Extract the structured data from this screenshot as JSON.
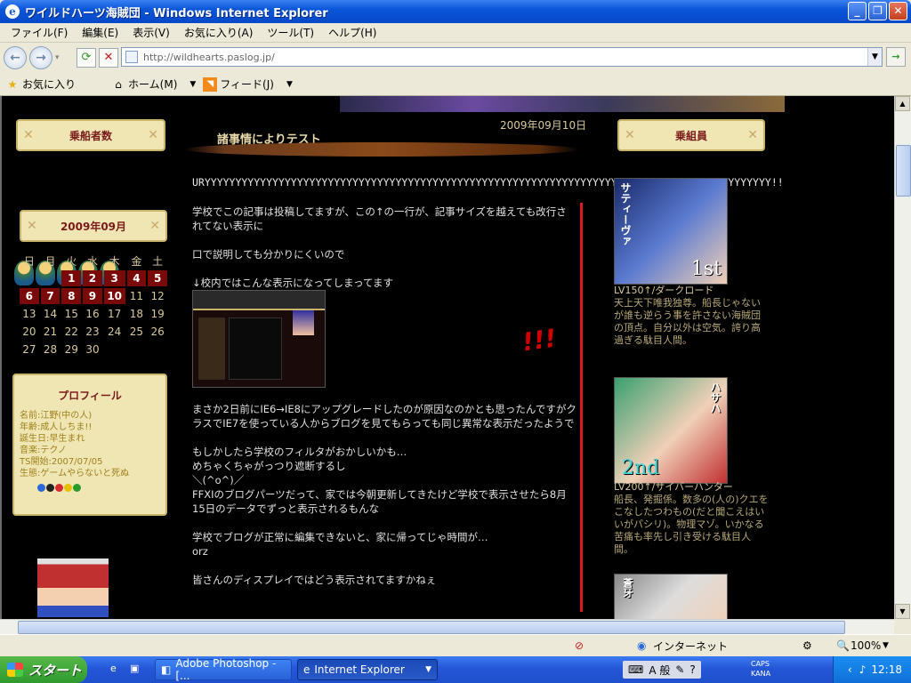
{
  "window": {
    "title": "ワイルドハーツ海賊団 - Windows Internet Explorer"
  },
  "menu": [
    "ファイル(F)",
    "編集(E)",
    "表示(V)",
    "お気に入り(A)",
    "ツール(T)",
    "ヘルプ(H)"
  ],
  "address": {
    "url": "http://wildhearts.paslog.jp/"
  },
  "links": {
    "favorites": "お気に入り",
    "home": "ホーム(M)",
    "feed": "フィード(J)"
  },
  "sidebar": {
    "crew_count_label": "乗船者数",
    "calendar_title": "2009年09月",
    "weekdays": [
      "日",
      "月",
      "火",
      "水",
      "木",
      "金",
      "土"
    ],
    "weeks": [
      [
        "",
        "",
        "1",
        "2",
        "3",
        "4",
        "5"
      ],
      [
        "6",
        "7",
        "8",
        "9",
        "10",
        "11",
        "12"
      ],
      [
        "13",
        "14",
        "15",
        "16",
        "17",
        "18",
        "19"
      ],
      [
        "20",
        "21",
        "22",
        "23",
        "24",
        "25",
        "26"
      ],
      [
        "27",
        "28",
        "29",
        "30",
        "",
        "",
        ""
      ]
    ],
    "highlight_days": [
      "1",
      "2",
      "3",
      "4",
      "5",
      "6",
      "7",
      "8",
      "9",
      "10"
    ],
    "profile_title": "プロフィール",
    "profile_lines": [
      "名前:江野(中の人)",
      "年齢:成人しちま!!",
      "誕生日:早生まれ",
      "音楽:テクノ",
      "TS開始:2007/07/05",
      "生態:ゲームやらないと死ぬ"
    ]
  },
  "post": {
    "date": "2009年09月10日",
    "title": "諸事情によりテスト",
    "ury": "URYYYYYYYYYYYYYYYYYYYYYYYYYYYYYYYYYYYYYYYYYYYYYYYYYYYYYYYYYYYYYYYYYYYYYYYYYYYYYYYYYYYYYYYYYYYY!!",
    "p1": "学校でこの記事は投稿してますが、この↑の一行が、記事サイズを越えても改行されてない表示に",
    "p2": "口で説明しても分かりにくいので",
    "p3": "↓校内ではこんな表示になってしまってます",
    "p4": "まさか2日前にIE6→IE8にアップグレードしたのが原因なのかとも思ったんですがクラスでIE7を使っている人からブログを見てもらっても同じ異常な表示だったようで",
    "p5a": "もしかしたら学校のフィルタがおかしいかも…",
    "p5b": "めちゃくちゃがっつり遮断するし",
    "p5c": "＼(^o^)／",
    "p5d": "FFXIのブログパーツだって、家では今朝更新してきたけど学校で表示させたら8月15日のデータでずっと表示されるもんな",
    "p6a": "学校でブログが正常に編集できないと、家に帰ってじゃ時間が…",
    "p6b": "orz",
    "p7": "皆さんのディスプレイではどう表示されてますかねぇ",
    "exclaim": "!!!"
  },
  "crew": {
    "label": "乗組員",
    "members": [
      {
        "name": "サティーヴァ",
        "rank": "1st",
        "level": "LV150↑/ダークロード",
        "desc": "天上天下唯我独尊。船長じゃないが誰も逆らう事を許さない海賊団の頂点。自分以外は空気。誇り高過ぎる駄目人間。"
      },
      {
        "name": "ハサハ",
        "rank": "2nd",
        "level": "LV200↑/サイバーハンター",
        "desc": "船長、発掘係。数多の(人の)クエをこなしたつわもの(だと聞こえはいいがパシリ)。物理マゾ。いかなる苦痛も率先し引き受ける駄目人間。"
      },
      {
        "name": "蒼牙",
        "rank": "3rd",
        "level": "",
        "desc": ""
      }
    ]
  },
  "status": {
    "zone": "インターネット",
    "zoom": "100%"
  },
  "taskbar": {
    "start": "スタート",
    "task1": "Adobe Photoshop - [...",
    "task2": "Internet Explorer",
    "ime": "A 般",
    "clock": "12:18",
    "caps": "CAPS",
    "kana": "KANA"
  }
}
